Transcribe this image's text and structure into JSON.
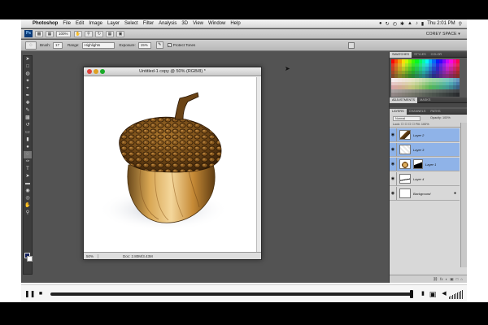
{
  "menubar": {
    "apple_glyph": "",
    "app_name": "Photoshop",
    "items": [
      "File",
      "Edit",
      "Image",
      "Layer",
      "Select",
      "Filter",
      "Analysis",
      "3D",
      "View",
      "Window",
      "Help"
    ],
    "clock": "Thu 2:01 PM"
  },
  "appbar": {
    "ps_label": "Ps",
    "zoom_value": "100%",
    "workspace": "COREY SPACE ▾"
  },
  "optbar": {
    "brush_label": "Brush:",
    "brush_size": "17",
    "range_label": "Range:",
    "range_value": "Highlights",
    "exposure_label": "Exposure:",
    "exposure_value": "15%",
    "protect_label": "Protect Tones"
  },
  "document": {
    "title": "Untitled-1 copy @ 50% (RGB/8) *",
    "zoom": "50%",
    "doc_size": "Doc: 2.80M/3.43M"
  },
  "panels": {
    "tabs_top": [
      "SWATCHES",
      "STYLES",
      "COLOR"
    ],
    "tabs_mid": [
      "ADJUSTMENTS",
      "MASKS"
    ],
    "tabs_layers": [
      "LAYERS",
      "CHANNELS",
      "PATHS"
    ],
    "blend_mode": "Normal",
    "opacity_label": "Opacity: 100%",
    "lock_label": "Lock:  ☐ ☐ ☐ ☐   Fill: 100%",
    "layers": [
      {
        "name": "Layer 2",
        "selected": true
      },
      {
        "name": "Layer 3",
        "selected": true
      },
      {
        "name": "Layer 1",
        "selected": true
      },
      {
        "name": "Layer 4",
        "selected": false
      },
      {
        "name": "Background",
        "selected": false
      }
    ],
    "footer_icons": [
      "⛓",
      "fx",
      "◐",
      "▣",
      "□",
      "⌂"
    ]
  },
  "colors": {
    "accent": "#8fb3e8",
    "workspace_bg": "#535353"
  }
}
